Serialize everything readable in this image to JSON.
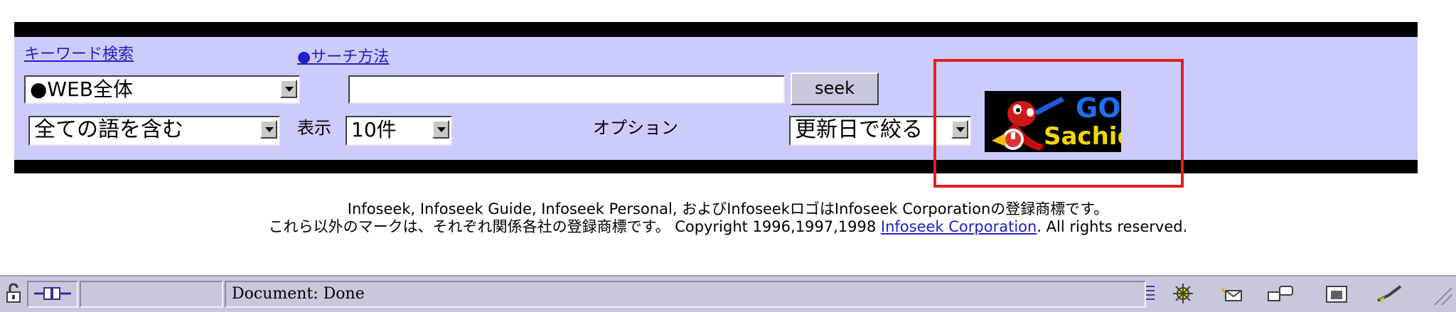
{
  "search": {
    "keyword_link": "キーワード検索",
    "method_link": "●サーチ方法",
    "scope_select": "●WEB全体",
    "query_value": "",
    "seek_button": "seek",
    "match_select": "全ての語を含む",
    "display_label": "表示",
    "count_select": "10件",
    "options_label": "オプション",
    "date_select": "更新日で絞る"
  },
  "banner": {
    "go_text": "GO!",
    "sachio_text": "Sachio"
  },
  "footer": {
    "line1": "Infoseek, Infoseek Guide, Infoseek Personal, およびInfoseekロゴはInfoseek Corporationの登録商標です。",
    "line2_prefix": "これら以外のマークは、それぞれ関係各社の登録商標です。 Copyright 1996,1997,1998 ",
    "line2_link": "Infoseek Corporation",
    "line2_suffix": ". All rights reserved."
  },
  "statusbar": {
    "status_text": "Document: Done",
    "icons": [
      "lock-icon",
      "connection-icon",
      "grip-icon",
      "navigator-icon",
      "mail-icon",
      "composer-icon",
      "address-book-icon",
      "editor-icon",
      "resize-grip-icon"
    ]
  },
  "colors": {
    "panel": "#ccccfc",
    "link": "#2020c8",
    "highlight_box": "#e02020",
    "statusbar": "#c8c8dc"
  }
}
